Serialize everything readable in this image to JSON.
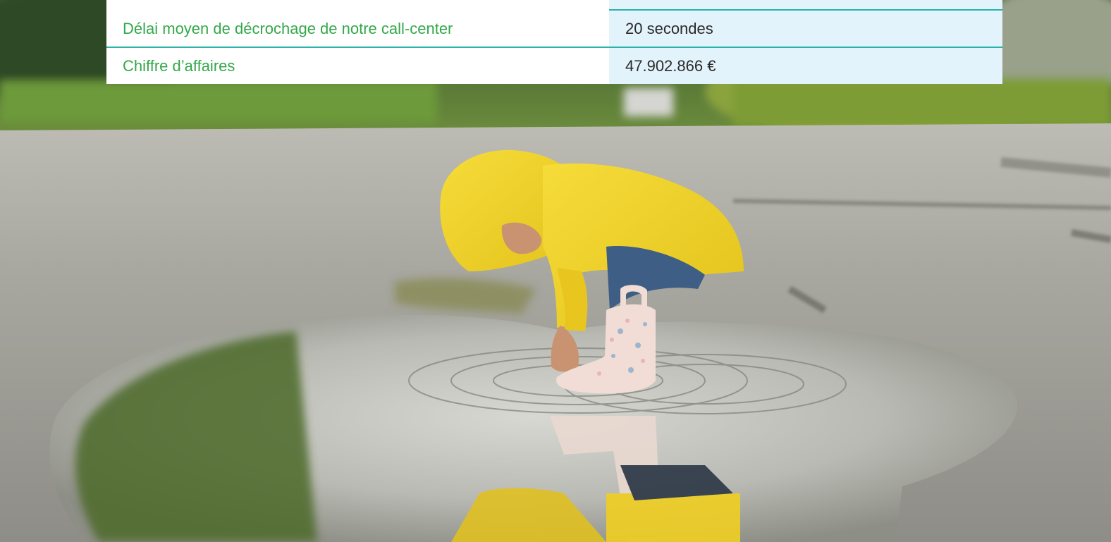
{
  "stats_table": {
    "rows": [
      {
        "label": "Délai moyen de décrochage de notre call-center",
        "value": "20 secondes"
      },
      {
        "label": "Chiffre d’affaires",
        "value": "47.902.866 €"
      }
    ]
  },
  "colors": {
    "label_green": "#33a84a",
    "divider_teal": "#2ab3a8",
    "value_bg": "#e3f3fb",
    "value_text": "#2a2a2a",
    "raincoat_yellow": "#f2d22a",
    "road_grey": "#a9a9a3"
  }
}
